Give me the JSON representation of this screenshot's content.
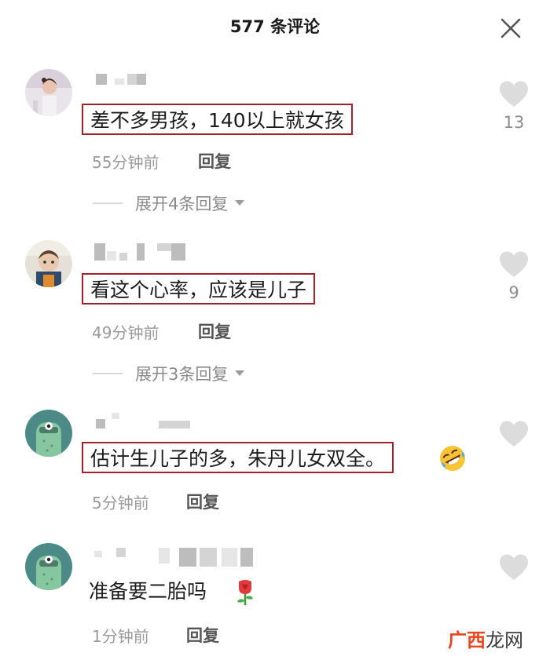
{
  "header": {
    "title": "577 条评论"
  },
  "comments": [
    {
      "text": "差不多男孩，140以上就女孩",
      "time": "55分钟前",
      "reply_label": "回复",
      "likes": "13",
      "expand_label": "展开4条回复"
    },
    {
      "text": "看这个心率，应该是儿子",
      "time": "49分钟前",
      "reply_label": "回复",
      "likes": "9",
      "expand_label": "展开3条回复"
    },
    {
      "text": "估计生儿子的多，朱丹儿女双全。",
      "time": "5分钟前",
      "reply_label": "回复",
      "likes": ""
    },
    {
      "text": "准备要二胎吗",
      "time": "1分钟前",
      "reply_label": "回复",
      "likes": ""
    }
  ],
  "icons": {
    "close": "close-icon",
    "like": "heart-icon",
    "expand": "chevron-down-icon",
    "emoji_laugh": "rofl-emoji-icon",
    "emoji_rose": "rose-emoji-icon"
  },
  "colors": {
    "highlight_box": "#a31f2b",
    "heart": "#dcdcdc",
    "watermark_accent": "#e8461e"
  },
  "watermark": {
    "part1": "广西",
    "part2": "龙网"
  }
}
